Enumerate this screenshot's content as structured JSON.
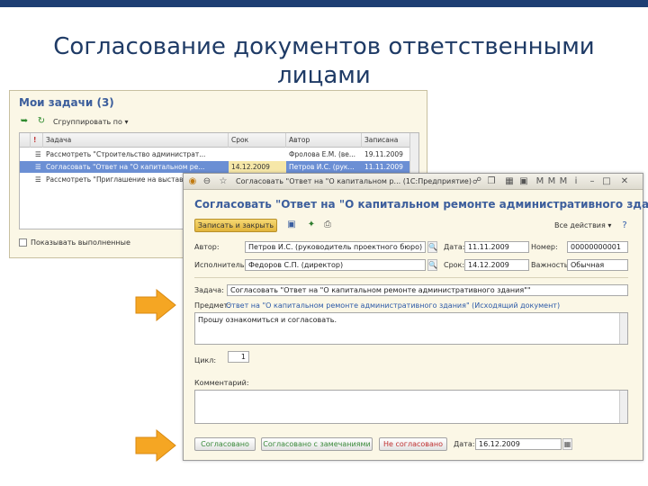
{
  "slide": {
    "title_line1": "Согласование документов ответственными",
    "title_line2": "лицами"
  },
  "tasks_window": {
    "title": "Мои задачи (3)",
    "toolbar": {
      "group_by": "Сгруппировать по"
    },
    "columns": [
      "Задача",
      "Срок",
      "Автор",
      "Записана"
    ],
    "rows": [
      {
        "task": "Рассмотреть \"Строительство администрат...",
        "due": "",
        "author": "Фролова Е.М. (ве...",
        "recorded": "19.11.2009"
      },
      {
        "task": "Согласовать \"Ответ на \"О капитальном ре...",
        "due": "14.12.2009",
        "author": "Петров И.С. (рук...",
        "recorded": "11.11.2009"
      },
      {
        "task": "Рассмотреть \"Приглашение на выставку...",
        "due": "",
        "author": "",
        "recorded": ""
      }
    ],
    "show_completed": "Показывать выполненные"
  },
  "form_window": {
    "caption": "Согласовать \"Ответ на \"О капитальном р... (1С:Предприятие)",
    "title": "Согласовать \"Ответ на \"О капитальном ремонте административного здани...",
    "save_close_button": "Записать и закрыть",
    "all_actions": "Все действия",
    "labels": {
      "author": "Автор:",
      "date": "Дата:",
      "number": "Номер:",
      "performer": "Исполнитель:",
      "due": "Срок:",
      "importance": "Важность:",
      "task": "Задача:",
      "subject": "Предмет:",
      "cycle": "Цикл:",
      "comment": "Комментарий:",
      "decision_date": "Дата:"
    },
    "values": {
      "author": "Петров И.С. (руководитель проектного бюро)",
      "date": "11.11.2009",
      "number": "00000000001",
      "performer": "Федоров С.П. (директор)",
      "due": "14.12.2009",
      "importance": "Обычная",
      "task": "Согласовать \"Ответ на \"О капитальном ремонте административного здания\"\"",
      "subject_link": "Ответ на \"О капитальном ремонте административного здания\" (Исходящий документ)",
      "description": "Прошу ознакомиться и согласовать.",
      "cycle": "1",
      "comment": "",
      "decision_date": "16.12.2009"
    },
    "buttons": {
      "approved": "Согласовано",
      "approved_with_remarks": "Согласовано с замечаниями",
      "not_approved": "Не согласовано"
    }
  },
  "colors": {
    "accent_blue": "#3c5e9c",
    "selection": "#6b8fd4",
    "window_bg": "#fbf7e6",
    "arrow_orange": "#f5a623",
    "approve_green": "#3a8a3a",
    "reject_red": "#c03030"
  }
}
